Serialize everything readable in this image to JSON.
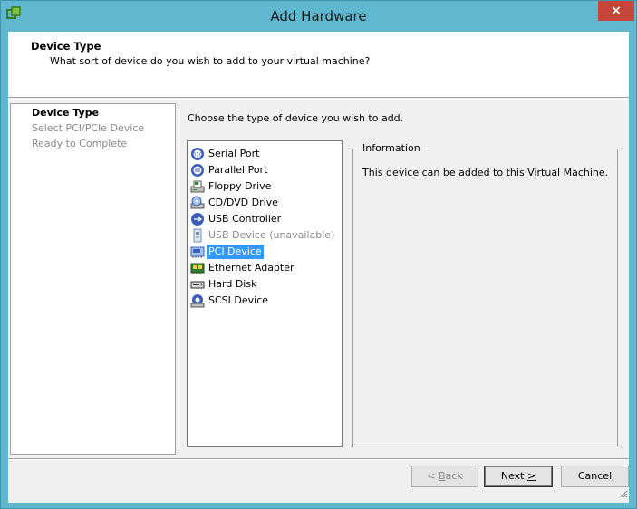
{
  "window": {
    "title": "Add Hardware",
    "close_label": "×"
  },
  "header": {
    "title": "Device Type",
    "subtitle": "What sort of device do you wish to add to your virtual machine?"
  },
  "steps": [
    {
      "label": "Device Type",
      "current": true
    },
    {
      "label": "Select PCI/PCIe Device",
      "current": false
    },
    {
      "label": "Ready to Complete",
      "current": false
    }
  ],
  "main": {
    "prompt": "Choose the type of device you wish to add.",
    "devices": [
      {
        "label": "Serial Port",
        "icon": "serial-port-icon",
        "enabled": true,
        "selected": false
      },
      {
        "label": "Parallel Port",
        "icon": "parallel-port-icon",
        "enabled": true,
        "selected": false
      },
      {
        "label": "Floppy Drive",
        "icon": "floppy-drive-icon",
        "enabled": true,
        "selected": false
      },
      {
        "label": "CD/DVD Drive",
        "icon": "cd-dvd-drive-icon",
        "enabled": true,
        "selected": false
      },
      {
        "label": "USB Controller",
        "icon": "usb-controller-icon",
        "enabled": true,
        "selected": false
      },
      {
        "label": "USB Device (unavailable)",
        "icon": "usb-device-icon",
        "enabled": false,
        "selected": false
      },
      {
        "label": "PCI Device",
        "icon": "pci-device-icon",
        "enabled": true,
        "selected": true
      },
      {
        "label": "Ethernet Adapter",
        "icon": "ethernet-adapter-icon",
        "enabled": true,
        "selected": false
      },
      {
        "label": "Hard Disk",
        "icon": "hard-disk-icon",
        "enabled": true,
        "selected": false
      },
      {
        "label": "SCSI Device",
        "icon": "scsi-device-icon",
        "enabled": true,
        "selected": false
      }
    ],
    "info": {
      "legend": "Information",
      "text": "This device can be added to this Virtual Machine."
    }
  },
  "buttons": {
    "back": {
      "pre": "< ",
      "key": "B",
      "post": "ack"
    },
    "next": {
      "pre": "Next ",
      "key": ">",
      "post": ""
    },
    "cancel": "Cancel"
  },
  "colors": {
    "title_bar": "#5fb8d0",
    "selection": "#3399ff",
    "close_button": "#c7463a"
  }
}
